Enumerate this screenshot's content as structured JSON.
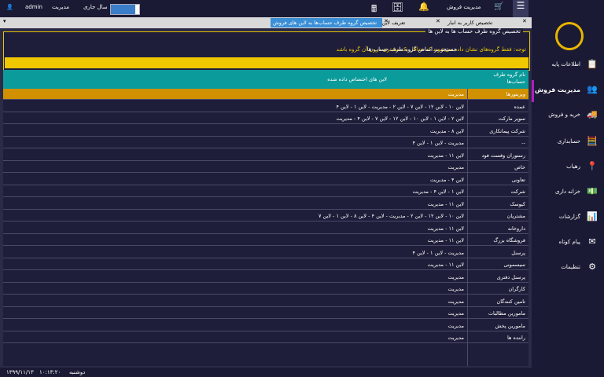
{
  "header": {
    "user": "admin",
    "role": "مدیریت",
    "year_label": "سال جاری",
    "year_progress": 0.85,
    "section": "مدیریت فروش"
  },
  "tabs": [
    {
      "label": "تخصیص کاربر به انبار"
    },
    {
      "label": "تعریف لاین جدید فروش"
    },
    {
      "label": "تخصیص گروه طرف حساب‌ها به لاین های فروش",
      "active": true
    }
  ],
  "form": {
    "group_title": "تخصیص گروه طرف حساب ها به لاین ها",
    "search_label": "جستجو بر اساس گروه طرف حساب ها",
    "note": "توجه: فقط گروه‌های نشان داده می‌شوند که حداقل یک مشتری درون آن گروه باشد"
  },
  "grid": {
    "col_group_name": "نام گروه طرف حساب‌ها",
    "col_lines": "لاین های اختصاص داده شده",
    "rows": [
      {
        "name": "ویزیتورها",
        "lines": "مدیریت",
        "highlight": true
      },
      {
        "name": "عمده",
        "lines": "لاین ۱۰ - لاین ۱۲ - لاین ۷ - لاین ۲ - مدیریت - لاین ۱ - لاین ۴"
      },
      {
        "name": "سوپر مارکت",
        "lines": "لاین ۲ - لاین ۱ - لاین ۱۰ - لاین ۱۲ - لاین ۷ - لاین ۴ - مدیریت"
      },
      {
        "name": "شرکت پیمانکاری",
        "lines": "لاین ۸ - مدیریت"
      },
      {
        "name": "--",
        "lines": "مدیریت - لاین ۱ - لاین ۴"
      },
      {
        "name": "رستوران وفست فود",
        "lines": "لاین ۱۱ - مدیریت"
      },
      {
        "name": "خاص",
        "lines": "مدیریت"
      },
      {
        "name": "تعاونی",
        "lines": "لاین ۴ - مدیریت"
      },
      {
        "name": "شرکت",
        "lines": "لاین ۱ - لاین ۴ - مدیریت"
      },
      {
        "name": "کیوسک",
        "lines": "لاین ۱۱ - مدیریت"
      },
      {
        "name": "مشتریان",
        "lines": "لاین ۱۰ - لاین ۱۲ - لاین ۲ - مدیریت - لاین ۴ - لاین ۸ - لاین ۱ - لاین ۷"
      },
      {
        "name": "داروخانه",
        "lines": "لاین ۱۱ - مدیریت"
      },
      {
        "name": "فروشگاه بزرگ",
        "lines": "لاین ۱۱ - مدیریت"
      },
      {
        "name": "پرسنل",
        "lines": "مدیریت - لاین ۱ - لاین ۴"
      },
      {
        "name": "سیسمونی",
        "lines": "لاین ۱۱ - مدیریت"
      },
      {
        "name": "پرسنل دفتری",
        "lines": "مدیریت"
      },
      {
        "name": "کارگران",
        "lines": "مدیریت"
      },
      {
        "name": "تامین کنندگان",
        "lines": "مدیریت"
      },
      {
        "name": "مامورین مطالبات",
        "lines": "مدیریت"
      },
      {
        "name": "مامورین پخش",
        "lines": "مدیریت"
      },
      {
        "name": "راننده ها",
        "lines": "مدیریت"
      }
    ]
  },
  "sidebar": {
    "items": [
      {
        "label": "اطلاعات پایه",
        "icon": "📋"
      },
      {
        "label": "مدیریت فروش",
        "icon": "👥",
        "active": true
      },
      {
        "label": "خرید و فروش",
        "icon": "🚚"
      },
      {
        "label": "حسابداری",
        "icon": "🧮"
      },
      {
        "label": "رهیاب",
        "icon": "📍"
      },
      {
        "label": "خزانه داری",
        "icon": "💵"
      },
      {
        "label": "گزارشات",
        "icon": "📊"
      },
      {
        "label": "پیام کوتاه",
        "icon": "✉"
      },
      {
        "label": "تنظیمات",
        "icon": "⚙"
      }
    ]
  },
  "status": {
    "date": "۱۳۹۹/۱۱/۱۳",
    "time": "۱۰:۱۳:۲۰",
    "day": "دوشنبه"
  }
}
